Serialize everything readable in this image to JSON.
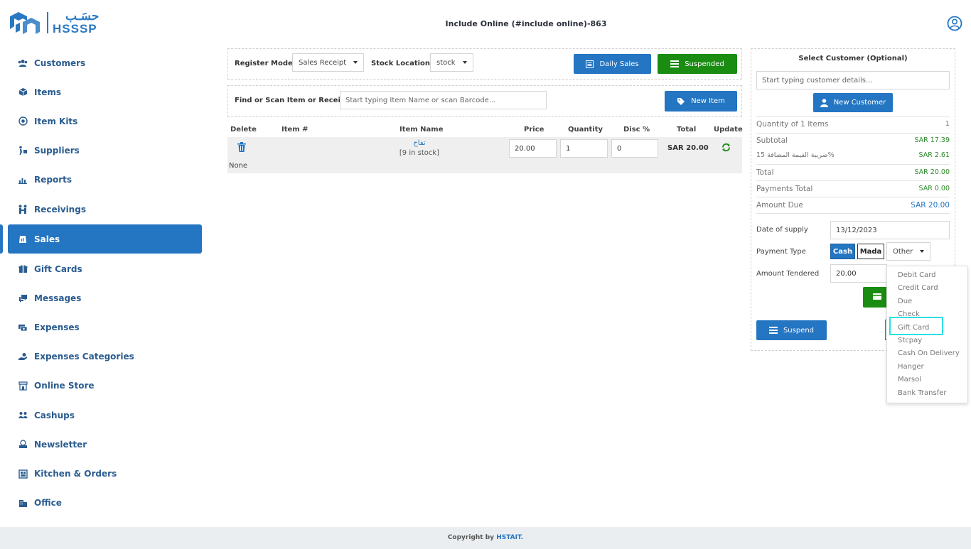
{
  "header": {
    "logo_ar": "حسَـب",
    "logo_en": "HSSSP",
    "title": "Include Online (#include online)-863"
  },
  "sidebar": {
    "items": [
      {
        "label": "Customers",
        "icon": "users-icon"
      },
      {
        "label": "Items",
        "icon": "box-icon"
      },
      {
        "label": "Item Kits",
        "icon": "kit-icon"
      },
      {
        "label": "Suppliers",
        "icon": "suppliers-icon"
      },
      {
        "label": "Reports",
        "icon": "chart-icon"
      },
      {
        "label": "Receivings",
        "icon": "receivings-icon"
      },
      {
        "label": "Sales",
        "icon": "sales-icon"
      },
      {
        "label": "Gift Cards",
        "icon": "gift-icon"
      },
      {
        "label": "Messages",
        "icon": "message-icon"
      },
      {
        "label": "Expenses",
        "icon": "expenses-icon"
      },
      {
        "label": "Expenses Categories",
        "icon": "hand-money-icon"
      },
      {
        "label": "Online Store",
        "icon": "store-icon"
      },
      {
        "label": "Cashups",
        "icon": "cashups-icon"
      },
      {
        "label": "Newsletter",
        "icon": "newsletter-icon"
      },
      {
        "label": "Kitchen & Orders",
        "icon": "kitchen-icon"
      },
      {
        "label": "Office",
        "icon": "office-icon"
      }
    ],
    "active": "Sales"
  },
  "register": {
    "mode_label": "Register Mode",
    "mode_value": "Sales Receipt",
    "stock_label": "Stock Location",
    "stock_value": "stock",
    "daily_sales": "Daily Sales",
    "suspended": "Suspended"
  },
  "find": {
    "label": "Find or Scan Item or Receipt",
    "placeholder": "Start typing Item Name or scan Barcode...",
    "new_item": "New Item"
  },
  "table": {
    "headers": [
      "Delete",
      "Item #",
      "Item Name",
      "Price",
      "Quantity",
      "Disc %",
      "Total",
      "Update"
    ],
    "row": {
      "item_name": "تفاح",
      "stock": "[9 in stock]",
      "price": "20.00",
      "quantity": "1",
      "discount": "0",
      "total": "SAR  20.00",
      "note": "None"
    }
  },
  "customer": {
    "title": "Select Customer (Optional)",
    "placeholder": "Start typing customer details...",
    "new_customer": "New Customer"
  },
  "summary": {
    "qty_label": "Quantity of 1 Items",
    "qty_value": "1",
    "subtotal_label": "Subtotal",
    "subtotal_value": "SAR  17.39",
    "vat_label": "ضريبة القيمة المضافة 15%",
    "vat_value": "SAR  2.61",
    "total_label": "Total",
    "total_value": "SAR  20.00",
    "payments_label": "Payments Total",
    "payments_value": "SAR  0.00",
    "due_label": "Amount Due",
    "due_value": "SAR  20.00"
  },
  "payment": {
    "date_label": "Date of supply",
    "date_value": "13/12/2023",
    "type_label": "Payment Type",
    "cash": "Cash",
    "mada": "Mada",
    "other": "Other",
    "tendered_label": "Amount Tendered",
    "tendered_value": "20.00",
    "suspend": "Suspend"
  },
  "dropdown": {
    "options": [
      "Debit Card",
      "Credit Card",
      "Due",
      "Check",
      "Gift Card",
      "Stcpay",
      "Cash On Delivery",
      "Hanger",
      "Marsol",
      "Bank Transfer"
    ],
    "highlighted": "Gift Card"
  },
  "footer": {
    "prefix": "Copyright by",
    "brand": "HSTAIT."
  },
  "colors": {
    "primary": "#2475c2",
    "success": "#1a8c12",
    "highlight": "#2de0e5"
  }
}
